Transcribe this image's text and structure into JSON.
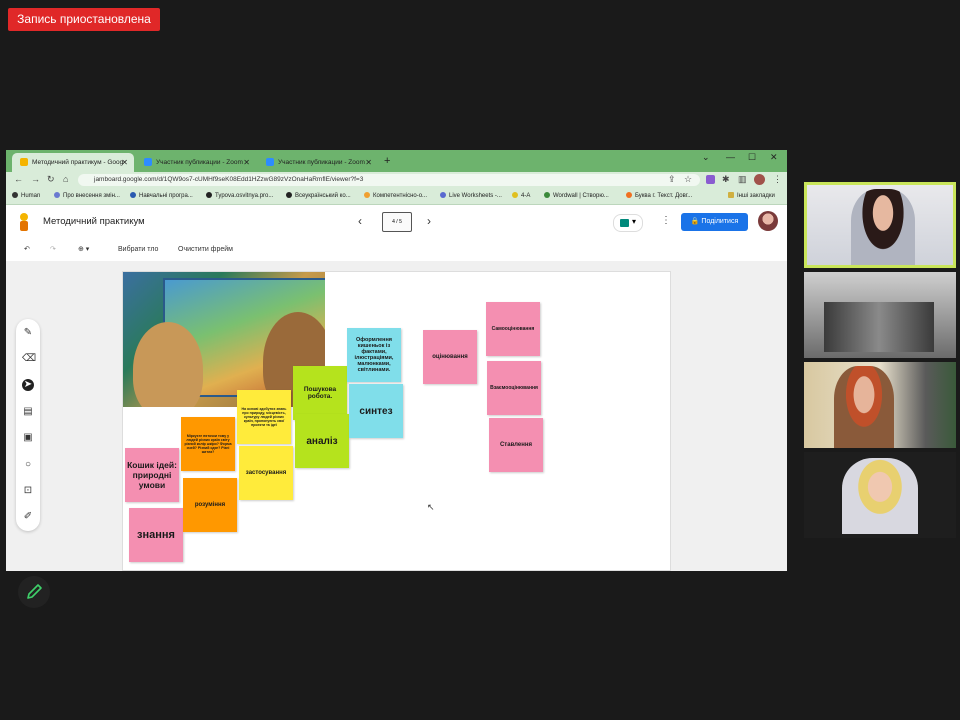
{
  "recording": {
    "label": "Запись приостановлена"
  },
  "browser": {
    "tabs": [
      {
        "label": "Методичний практикум - Goog",
        "active": true
      },
      {
        "label": "Участник публикации - Zoom",
        "active": false
      },
      {
        "label": "Участник публикации - Zoom",
        "active": false
      }
    ],
    "new_tab": "+",
    "url": "jamboard.google.com/d/1QW9os7-cUMHf9seK08Edd1HZzwG89zVzOnaHaRmflE/viewer?f=3",
    "bookmarks": [
      "Human",
      "Про внесення змін...",
      "Навчальні програ...",
      "Typova.osvitnya.pro...",
      "Всеукраїнський ко...",
      "Компетентнісно-о...",
      "Live Worksheets -...",
      "4-А",
      "Wordwall | Створю...",
      "Буква г. Текст. Довг...",
      "Інші закладки"
    ]
  },
  "jamboard": {
    "title": "Методичний практикум",
    "frame_indicator": "4 / 5",
    "share_label": "Поділитися",
    "toolbar": {
      "set_background": "Вибрати тло",
      "clear_frame": "Очистити фрейм"
    },
    "notes": {
      "kit": "Кошик ідей: природні умови",
      "knowledge": "знання",
      "understanding": "розуміння",
      "understanding_q": "Міркуєте пяточки тому у людей різних країн світу різний колір шкіри? Форма очей? Різний одяг? Різні житла?",
      "application": "застосування",
      "application_q": "На основі здобутих знань про природу, місцевість, культуру людей різних країн, пропонують свої проекти та ідеї",
      "research": "Пошукова робота.",
      "analysis": "аналіз",
      "design": "Оформлення кишеньок із фактами, ілюстраціями, малюнками, світлинами.",
      "synthesis": "синтез",
      "evaluation": "оцінювання",
      "self_eval": "Самооцінювання",
      "peer_eval": "Взаємооцінювання",
      "creation": "Ставлення"
    }
  },
  "colors": {
    "note_pink": "#f48fb1",
    "note_orange": "#ff9800",
    "note_yellow": "#ffeb3b",
    "note_green": "#b5e31d",
    "note_cyan": "#80deea",
    "share_blue": "#1a73e8",
    "tab_green": "#6db36d"
  },
  "icons": [
    "back-icon",
    "forward-icon",
    "reload-icon",
    "home-icon",
    "undo-icon",
    "redo-icon",
    "zoom-icon",
    "pen-icon",
    "eraser-icon",
    "select-icon",
    "sticky-note-icon",
    "image-icon",
    "circle-icon",
    "textbox-icon",
    "laser-icon"
  ]
}
